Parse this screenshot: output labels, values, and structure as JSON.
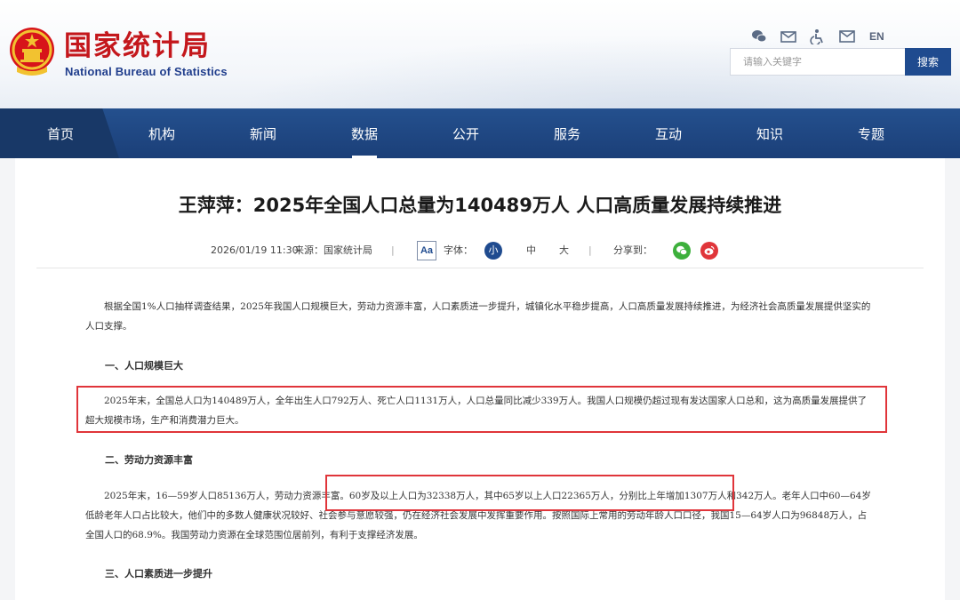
{
  "site": {
    "name_cn": "国家统计局",
    "name_en": "National Bureau of Statistics",
    "emblem_icon": "national-emblem-icon"
  },
  "tools": {
    "items": [
      "wechat-icon",
      "mail-icon",
      "accessibility-icon",
      "email-icon"
    ],
    "lang": "EN"
  },
  "search": {
    "placeholder": "请输入关键字",
    "button": "搜索"
  },
  "nav": {
    "items": [
      "首页",
      "机构",
      "新闻",
      "数据",
      "公开",
      "服务",
      "互动",
      "知识",
      "专题"
    ],
    "active": "数据"
  },
  "article": {
    "title": "王萍萍：2025年全国人口总量为140489万人 人口高质量发展持续推进",
    "date": "2026/01/19 11:30",
    "source_label": "来源：国家统计局",
    "sep": "|",
    "aa": "Aa",
    "font_label": "字体：",
    "font_sizes": [
      "小",
      "中",
      "大"
    ],
    "share_label": "分享到：",
    "paragraphs": [
      "根据全国1%人口抽样调查结果，2025年我国人口规模巨大，劳动力资源丰富，人口素质进一步提升，城镇化水平稳步提高，人口高质量发展持续推进，为经济社会高质量发展提供坚实的人口支撑。",
      "2025年末，全国总人口为140489万人，全年出生人口792万人、死亡人口1131万人，人口总量同比减少339万人。我国人口规模仍超过现有发达国家人口总和，这为高质量发展提供了超大规模市场，生产和消费潜力巨大。",
      "2025年末，16—59岁人口85136万人，劳动力资源丰富。60岁及以上人口为32338万人，其中65岁以上人口22365万人，分别比上年增加1307万人和342万人。老年人口中60—64岁低龄老年人口占比较大，他们中的多数人健康状况较好、社会参与意愿较强，仍在经济社会发展中发挥重要作用。按照国际上常用的劳动年龄人口口径，我国15—64岁人口为96848万人，占全国人口的68.9%。我国劳动力资源在全球范围位居前列，有利于支撑经济发展。"
    ],
    "headings": [
      "一、人口规模巨大",
      "二、劳动力资源丰富",
      "三、人口素质进一步提升"
    ]
  },
  "colors": {
    "brand_red": "#c4171c",
    "nav_blue": "#1f4b8f",
    "highlight_red": "#e0353a"
  }
}
